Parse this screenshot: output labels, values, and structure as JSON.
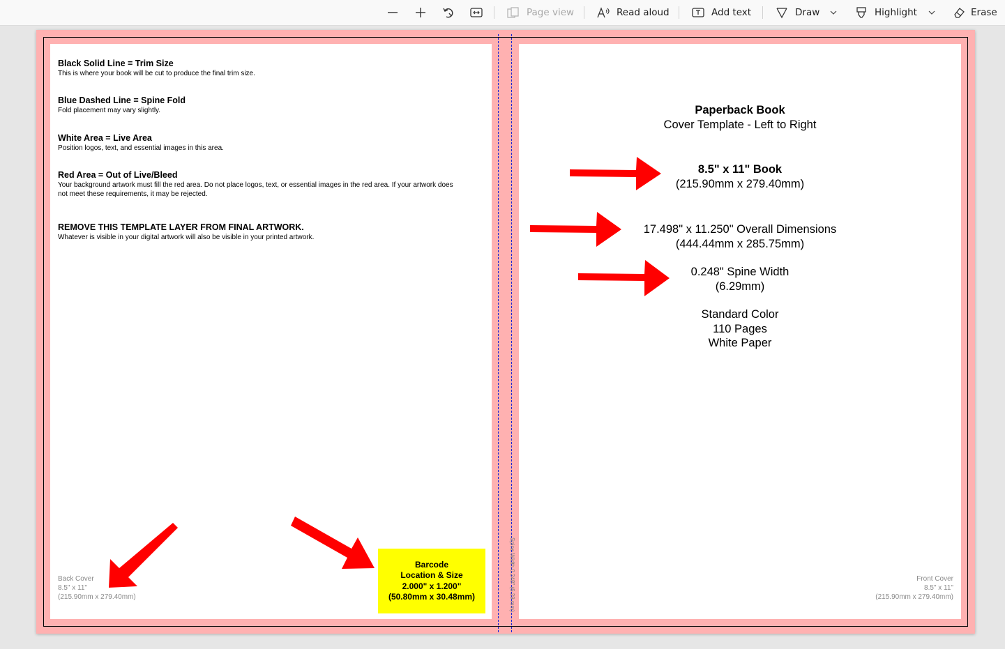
{
  "toolbar": {
    "zoom_out_icon": "minus-icon",
    "zoom_in_icon": "plus-icon",
    "rotate_icon": "rotate-icon",
    "fit_icon": "fit-width-icon",
    "page_view": "Page view",
    "read_aloud": "Read aloud",
    "add_text": "Add text",
    "draw": "Draw",
    "highlight": "Highlight",
    "erase": "Erase"
  },
  "document": {
    "instructions": [
      {
        "heading": "Black Solid Line = Trim Size",
        "lines": [
          "This is where your book will be cut to produce the final trim size."
        ]
      },
      {
        "heading": "Blue Dashed Line = Spine Fold",
        "lines": [
          "Fold placement may vary slightly."
        ]
      },
      {
        "heading": "White Area = Live Area",
        "lines": [
          "Position logos, text, and essential images in this area."
        ]
      },
      {
        "heading": "Red Area = Out of Live/Bleed",
        "lines": [
          "Your background artwork must fill the red area. Do not place logos, text, or essential images in the red area. If your artwork does",
          "not meet these requirements, it may be rejected."
        ]
      },
      {
        "heading": "REMOVE THIS TEMPLATE LAYER FROM FINAL ARTWORK.",
        "lines": [
          "Whatever is visible in your digital artwork will also be visible in your printed artwork."
        ]
      }
    ],
    "back_cover": [
      "Back Cover",
      "8.5\" x 11\"",
      "(215.90mm x 279.40mm)"
    ],
    "front_cover": [
      "Front Cover",
      "8.5\" x 11\"",
      "(215.90mm x 279.40mm)"
    ],
    "barcode": [
      "Barcode",
      "Location & Size",
      "2.000\" x 1.200\"",
      "(50.80mm x 30.48mm)"
    ],
    "spine_label": "Spine Width 0.248\" (6.29 mm)",
    "front_title": "Paperback Book",
    "front_subtitle": "Cover Template - Left to Right",
    "book_size": "8.5\" x 11\" Book",
    "book_size_mm": "(215.90mm x 279.40mm)",
    "overall": "17.498\" x 11.250\" Overall Dimensions",
    "overall_mm": "(444.44mm x 285.75mm)",
    "spine": "0.248\" Spine Width",
    "spine_mm": "(6.29mm)",
    "specs": [
      "Standard Color",
      "110 Pages",
      "White Paper"
    ]
  },
  "colors": {
    "bleed": "#ffb1b1",
    "spine_fold": "#1c22d8",
    "arrow": "#ff0000",
    "barcode": "#ffff00"
  }
}
